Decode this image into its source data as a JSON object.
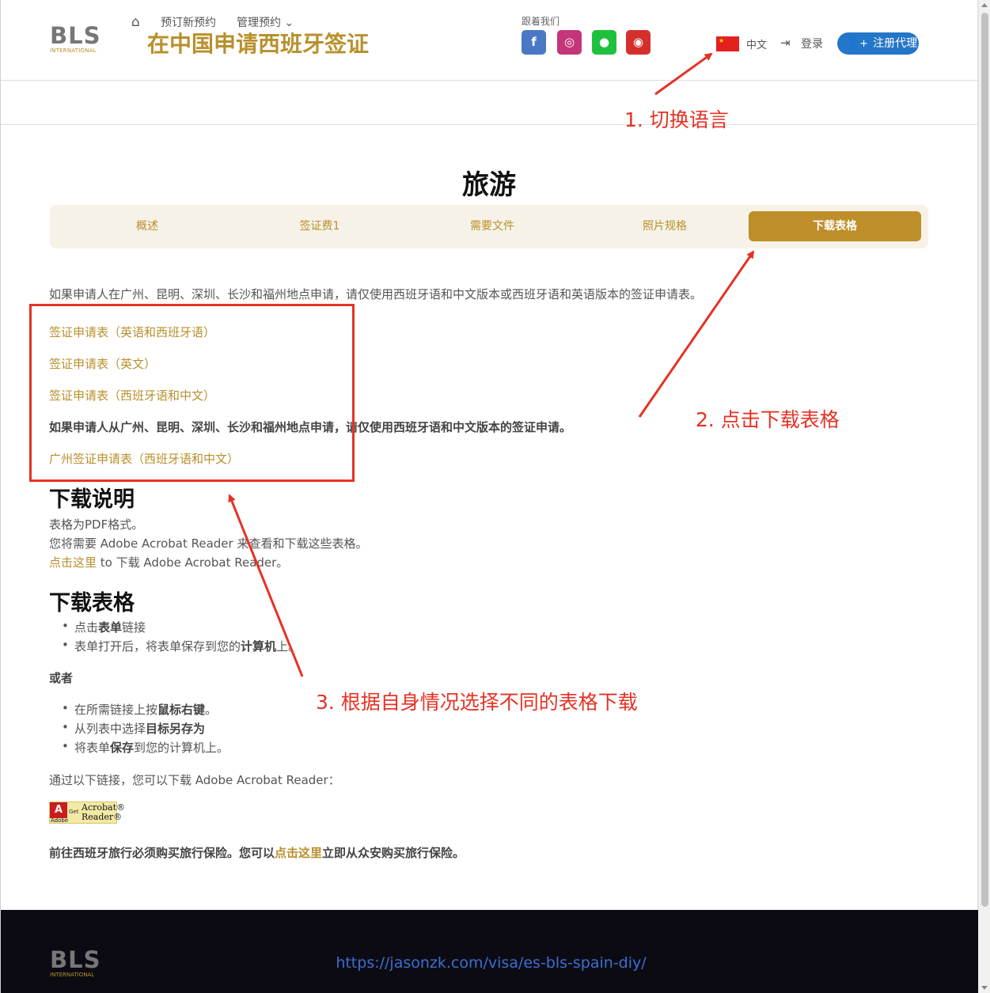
{
  "header": {
    "logo_text": "BLS",
    "logo_sub": "INTERNATIONAL",
    "site_title": "在中国申请西班牙签证",
    "follow_label": "跟着我们",
    "social": [
      {
        "name": "facebook-icon",
        "glyph": "f"
      },
      {
        "name": "instagram-icon",
        "glyph": "◎"
      },
      {
        "name": "wechat-icon",
        "glyph": "●"
      },
      {
        "name": "weibo-icon",
        "glyph": "◉"
      }
    ],
    "language": "中文",
    "login": "登录",
    "register": "注册代理"
  },
  "nav": {
    "new_booking": "预订新预约",
    "manage_booking": "管理预约"
  },
  "main": {
    "heading": "旅游",
    "tabs": [
      "概述",
      "签证费1",
      "需要文件",
      "照片规格",
      "下载表格"
    ],
    "active_tab": 4,
    "intro": "如果申请人在广州、昆明、深圳、长沙和福州地点申请，请仅使用西班牙语和中文版本或西班牙语和英语版本的签证申请表。",
    "form_links": [
      "签证申请表（英语和西班牙语）",
      "签证申请表（英文）",
      "签证申请表（西班牙语和中文）"
    ],
    "location_note": "如果申请人从广州、昆明、深圳、长沙和福州地点申请，请仅使用西班牙语和中文版本的签证申请。",
    "guangzhou_link": "广州签证申请表（西班牙语和中文）",
    "download_instructions_title": "下载说明",
    "instr_line1": "表格为PDF格式。",
    "instr_line2": "您将需要 Adobe Acrobat Reader 来查看和下载这些表格。",
    "instr_link": "点击这里",
    "instr_line3_rest": " to 下载 Adobe Acrobat Reader。",
    "download_forms_title": "下载表格",
    "bullets1": [
      {
        "pre": "点击",
        "bold": "表单",
        "post": "链接"
      },
      {
        "pre": "表单打开后，将表单保存到您的",
        "bold": "计算机",
        "post": "上。"
      }
    ],
    "or_label": "或者",
    "bullets2": [
      {
        "pre": "在所需链接上按",
        "bold": "鼠标右键",
        "post": "。"
      },
      {
        "pre": "从列表中选择",
        "bold": "目标另存为",
        "post": ""
      },
      {
        "pre": "将表单",
        "bold": "保存",
        "post": "到您的计算机上。"
      }
    ],
    "acrobat_line": "通过以下链接，您可以下载 Adobe Acrobat Reader：",
    "acrobat_badge": {
      "letter": "A",
      "adobe": "Adobe",
      "get": "Get",
      "acrobat": "Acrobat®",
      "reader": "Reader®"
    },
    "insurance_pre": "前往西班牙旅行必须购买旅行保险。您可以",
    "insurance_link": "点击这里",
    "insurance_post": "立即从众安购买旅行保险。"
  },
  "footer": {
    "logo_text": "BLS",
    "logo_sub": "INTERNATIONAL",
    "url": "https://jasonzk.com/visa/es-bls-spain-diy/"
  },
  "annotations": {
    "step1": "1. 切换语言",
    "step2": "2. 点击下载表格",
    "step3": "3. 根据自身情况选择不同的表格下载"
  },
  "colors": {
    "brand_gold": "#b8902c",
    "register_blue": "#2476c8",
    "annotation_red": "#e53224",
    "footer_bg": "#0c0b14"
  }
}
